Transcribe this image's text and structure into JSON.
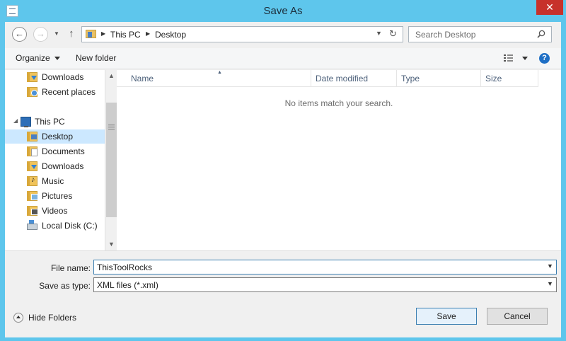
{
  "window": {
    "title": "Save As",
    "close_glyph": "✕"
  },
  "address_bar": {
    "crumbs": [
      "This PC",
      "Desktop"
    ],
    "back_glyph": "←",
    "forward_glyph": "→",
    "up_glyph": "↑",
    "refresh_glyph": "↻"
  },
  "search": {
    "placeholder": "Search Desktop"
  },
  "toolbar": {
    "organize_label": "Organize",
    "new_folder_label": "New folder",
    "help_glyph": "?"
  },
  "navigation": {
    "items": [
      {
        "label": "Downloads",
        "icon": "downloads-folder-icon"
      },
      {
        "label": "Recent places",
        "icon": "recent-places-icon"
      },
      {
        "label": "This PC",
        "icon": "computer-icon"
      },
      {
        "label": "Desktop",
        "icon": "desktop-folder-icon",
        "selected": true
      },
      {
        "label": "Documents",
        "icon": "documents-folder-icon"
      },
      {
        "label": "Downloads",
        "icon": "downloads-folder-icon"
      },
      {
        "label": "Music",
        "icon": "music-folder-icon"
      },
      {
        "label": "Pictures",
        "icon": "pictures-folder-icon"
      },
      {
        "label": "Videos",
        "icon": "videos-folder-icon"
      },
      {
        "label": "Local Disk (C:)",
        "icon": "drive-icon"
      }
    ]
  },
  "file_list": {
    "columns": [
      "Name",
      "Date modified",
      "Type",
      "Size"
    ],
    "empty_message": "No items match your search."
  },
  "form": {
    "file_name_label": "File name:",
    "file_name_value": "ThisToolRocks",
    "save_type_label": "Save as type:",
    "save_type_value": "XML files (*.xml)"
  },
  "footer": {
    "hide_folders_label": "Hide Folders",
    "save_label": "Save",
    "cancel_label": "Cancel"
  }
}
